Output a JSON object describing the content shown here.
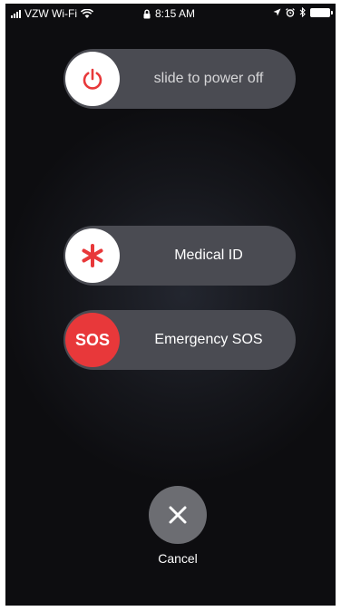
{
  "status_bar": {
    "carrier": "VZW Wi-Fi",
    "time": "8:15 AM",
    "icons": [
      "signal-bars-icon",
      "wifi-icon",
      "lock-icon",
      "location-arrow-icon",
      "alarm-icon",
      "bluetooth-icon",
      "battery-icon"
    ]
  },
  "power_slider": {
    "label": "slide to power off",
    "icon": "power-icon",
    "icon_color": "#e8383a"
  },
  "medical_slider": {
    "label": "Medical ID",
    "icon": "asterisk-icon",
    "icon_color": "#e8383a"
  },
  "sos_slider": {
    "label": "Emergency SOS",
    "knob_text": "SOS",
    "knob_color": "#e8383a"
  },
  "cancel": {
    "label": "Cancel",
    "icon": "close-icon"
  }
}
